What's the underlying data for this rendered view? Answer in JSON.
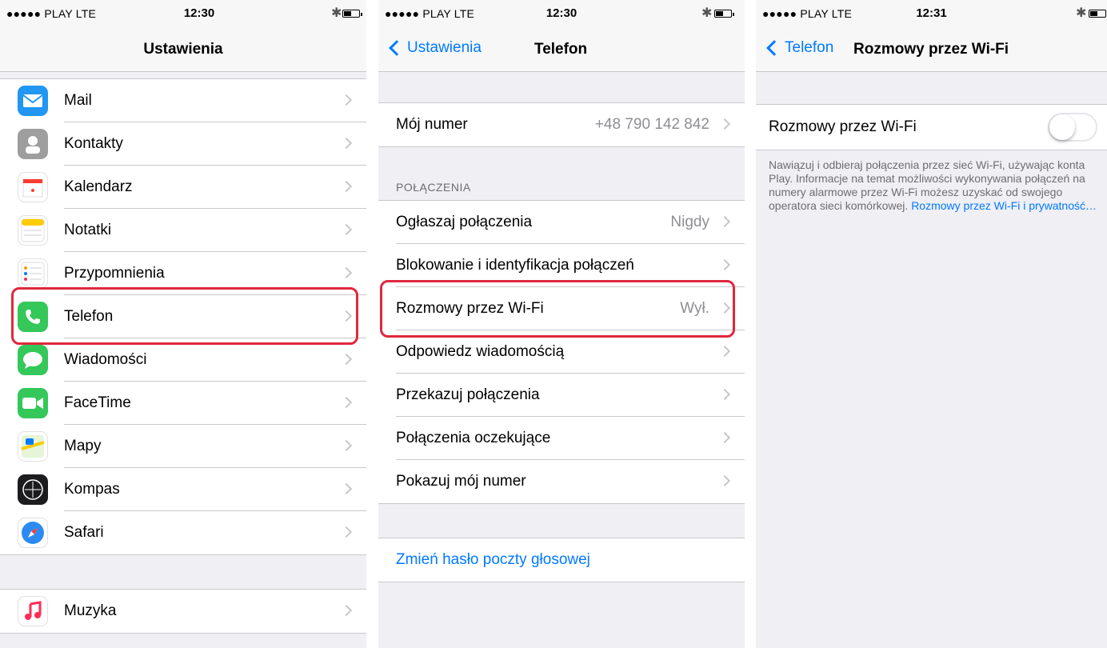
{
  "screens": [
    {
      "status": {
        "carrier": "●●●●● PLAY  LTE",
        "time": "12:30"
      },
      "nav": {
        "title": "Ustawienia"
      },
      "items": [
        {
          "label": "Mail",
          "icon": "mail-icon",
          "color": "#2196f3"
        },
        {
          "label": "Kontakty",
          "icon": "contacts-icon",
          "color": "#9e9e9e"
        },
        {
          "label": "Kalendarz",
          "icon": "calendar-icon",
          "color": "#ffffff"
        },
        {
          "label": "Notatki",
          "icon": "notes-icon",
          "color": "#ffffff"
        },
        {
          "label": "Przypomnienia",
          "icon": "reminders-icon",
          "color": "#ffffff"
        },
        {
          "label": "Telefon",
          "icon": "phone-icon",
          "color": "#34c759"
        },
        {
          "label": "Wiadomości",
          "icon": "messages-icon",
          "color": "#34c759"
        },
        {
          "label": "FaceTime",
          "icon": "facetime-icon",
          "color": "#34c759"
        },
        {
          "label": "Mapy",
          "icon": "maps-icon",
          "color": "#ffffff"
        },
        {
          "label": "Kompas",
          "icon": "compass-icon",
          "color": "#1c1c1e"
        },
        {
          "label": "Safari",
          "icon": "safari-icon",
          "color": "#ffffff"
        }
      ],
      "items2": [
        {
          "label": "Muzyka",
          "icon": "music-icon",
          "color": "#ffffff"
        }
      ]
    },
    {
      "status": {
        "carrier": "●●●●● PLAY  LTE",
        "time": "12:30"
      },
      "nav": {
        "back": "Ustawienia",
        "title": "Telefon"
      },
      "my_number": {
        "label": "Mój numer",
        "value": "+48 790 142 842"
      },
      "section_header": "POŁĄCZENIA",
      "items": [
        {
          "label": "Ogłaszaj połączenia",
          "value": "Nigdy"
        },
        {
          "label": "Blokowanie i identyfikacja połączeń",
          "value": ""
        },
        {
          "label": "Rozmowy przez Wi-Fi",
          "value": "Wył."
        },
        {
          "label": "Odpowiedz wiadomością",
          "value": ""
        },
        {
          "label": "Przekazuj połączenia",
          "value": ""
        },
        {
          "label": "Połączenia oczekujące",
          "value": ""
        },
        {
          "label": "Pokazuj mój numer",
          "value": ""
        }
      ],
      "voicemail_link": "Zmień hasło poczty głosowej"
    },
    {
      "status": {
        "carrier": "●●●●● PLAY  LTE",
        "time": "12:31"
      },
      "nav": {
        "back": "Telefon",
        "title": "Rozmowy przez Wi-Fi"
      },
      "toggle_row": {
        "label": "Rozmowy przez Wi-Fi",
        "on": false
      },
      "footer": "Nawiązuj i odbieraj połączenia przez sieć Wi-Fi, używając konta Play. Informacje na temat możliwości wykonywania połączeń na numery alarmowe przez Wi-Fi możesz uzyskać od swojego operatora sieci komórkowej.",
      "footer_link": "Rozmowy przez Wi-Fi i prywatność…"
    }
  ],
  "colors": {
    "accent": "#007aff",
    "highlight": "#e0283c"
  }
}
